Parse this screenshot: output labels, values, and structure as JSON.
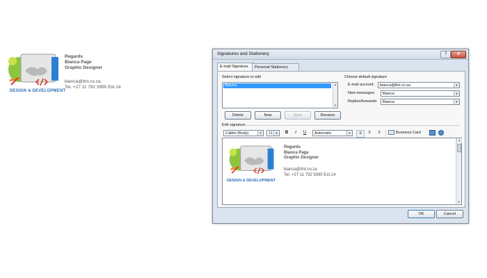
{
  "preview": {
    "logo_caption": "DESIGN & DEVELOPMENT",
    "lines": [
      "Regards",
      "Bianca Page",
      "Graphic Designer"
    ],
    "email": "bianca@ltnt.co.za",
    "tel": "Tel. +27 11 792 5990 Ext.14"
  },
  "dialog": {
    "title": "Signatures and Stationery",
    "help": "?",
    "close": "✕",
    "tabs": [
      "E-mail Signature",
      "Personal Stationery"
    ],
    "select_label": "Select signature to edit",
    "signatures": [
      "Bianca"
    ],
    "buttons": {
      "delete": "Delete",
      "new": "New",
      "save": "Save",
      "rename": "Rename"
    },
    "default_heading": "Choose default signature",
    "email_account_label": "E-mail account:",
    "email_account_value": "bianca@ltnt.co.za",
    "new_messages_label": "New messages:",
    "new_messages_value": "Bianca",
    "replies_label": "Replies/forwards:",
    "replies_value": "Bianca",
    "edit_label": "Edit signature",
    "font_name": "Calibri (Body)",
    "font_size": "11",
    "color": "Automatic",
    "business_card": "Business Card",
    "ok": "OK",
    "cancel": "Cancel"
  },
  "editor": {
    "logo_caption": "DESIGN & DEVELOPMENT",
    "lines": [
      "Regards",
      "Bianca Page",
      "Graphic Designer"
    ],
    "email": "bianca@ltnt.co.za",
    "tel": "Tel. +27 11 792 5990 Ext.14"
  }
}
